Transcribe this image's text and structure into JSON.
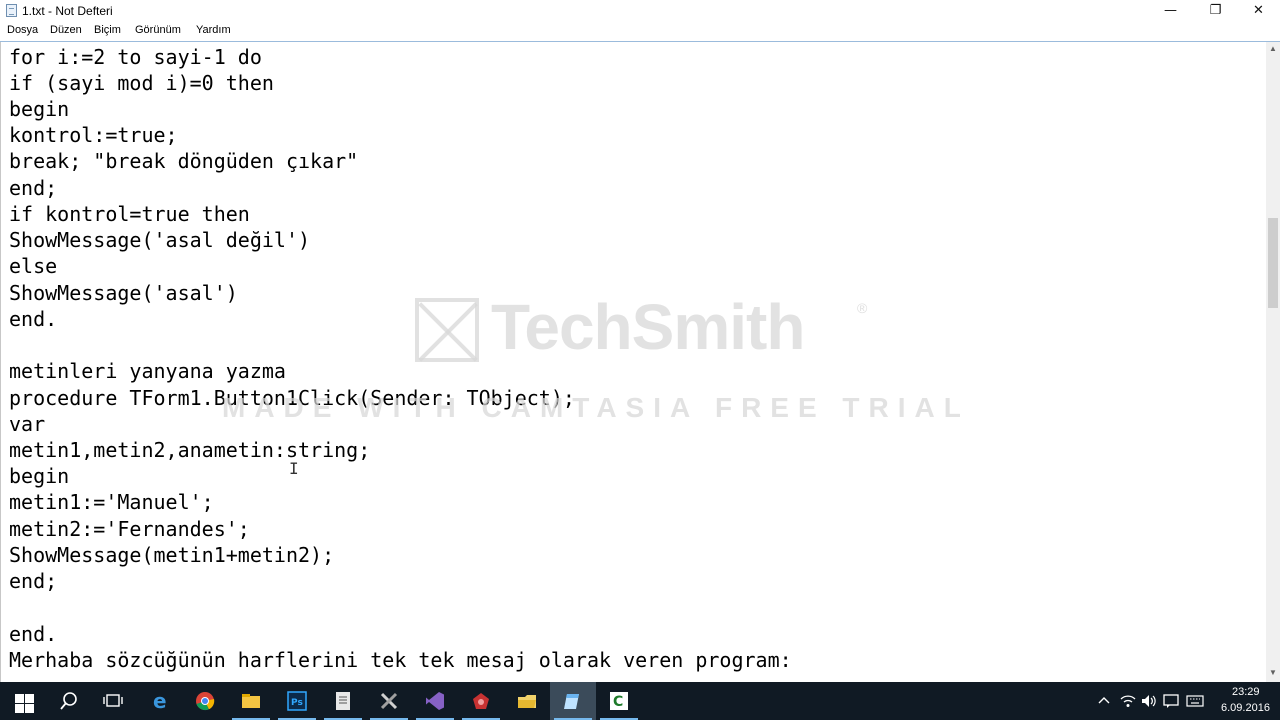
{
  "window": {
    "title": "1.txt - Not Defteri",
    "controls": [
      "—",
      "❐",
      "✕"
    ]
  },
  "menu": [
    "Dosya",
    "Düzen",
    "Biçim",
    "Görünüm",
    "Yardım"
  ],
  "editor": {
    "lines": [
      "for i:=2 to sayi-1 do",
      "if (sayi mod i)=0 then",
      "begin",
      "kontrol:=true;",
      "break; \"break döngüden çıkar\"",
      "end;",
      "if kontrol=true then",
      "ShowMessage('asal değil')",
      "else",
      "ShowMessage('asal')",
      "end.",
      "",
      "metinleri yanyana yazma",
      "procedure TForm1.Button1Click(Sender: TObject);",
      "var",
      "metin1,metin2,anametin:string;",
      "begin",
      "metin1:='Manuel';",
      "metin2:='Fernandes';",
      "ShowMessage(metin1+metin2);",
      "end;",
      "",
      "end.",
      "Merhaba sözcüğünün harflerini tek tek mesaj olarak veren program:"
    ]
  },
  "watermark": {
    "brand": "TechSmith",
    "registered": "®",
    "subtitle": "MADE WITH CAMTASIA FREE TRIAL"
  },
  "taskbar": {
    "apps": [
      "start",
      "search",
      "task-view",
      "edge",
      "chrome",
      "file-explorer",
      "photoshop",
      "document-app",
      "tools-app",
      "visual-studio",
      "red-app",
      "folder-app",
      "notepad",
      "codeblocks"
    ],
    "tray_icons": [
      "^",
      "network",
      "volume",
      "message",
      "keyboard"
    ],
    "time": "23:29",
    "date": "6.09.2016"
  },
  "colors": {
    "taskbar": "#101a24",
    "menu_border": "#9bbbdc",
    "accent": "#76b9ed"
  }
}
